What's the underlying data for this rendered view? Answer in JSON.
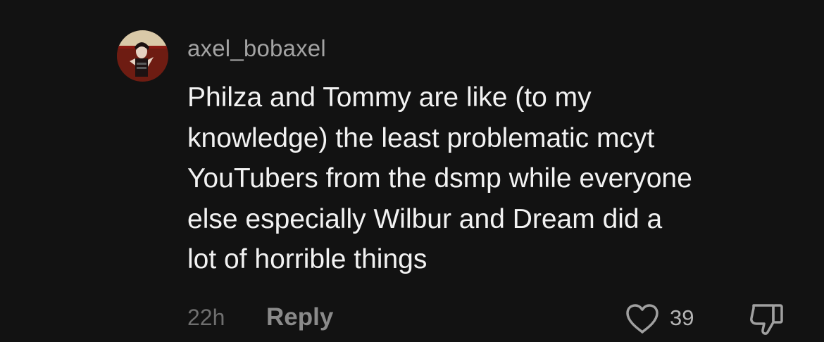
{
  "comment": {
    "avatar_icon": "user-avatar-photo",
    "username": "axel_bobaxel",
    "text_lines": [
      "Philza and Tommy are like (to my",
      "knowledge) the least problematic mcyt",
      "YouTubers from the dsmp while everyone",
      "else especially Wilbur and Dream did a",
      "lot of horrible things"
    ],
    "timestamp": "22h",
    "reply_label": "Reply",
    "like_icon": "heart-icon",
    "like_count": "39",
    "dislike_icon": "thumbs-down-icon"
  },
  "colors": {
    "background": "#121212",
    "text": "#f2f2f2",
    "username": "#a3a3a3",
    "muted": "#6f6f6f"
  }
}
